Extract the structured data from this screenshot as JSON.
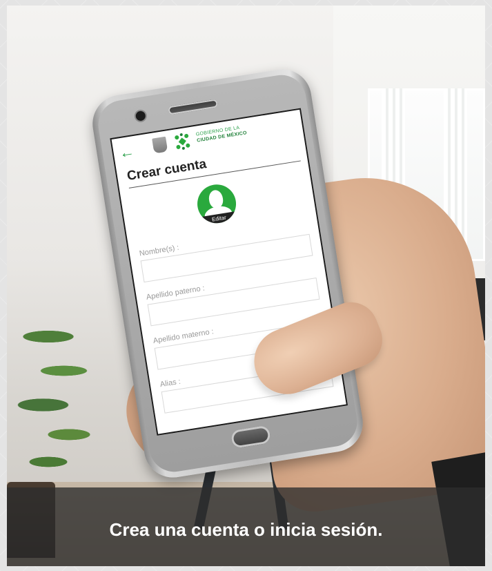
{
  "app": {
    "header": {
      "back_icon": "arrow-left-icon",
      "gov_line1": "GOBIERNO DE LA",
      "gov_line2": "CIUDAD DE MÉXICO",
      "logo_icon": "cdmx-logo-icon",
      "crest_icon": "coat-of-arms-icon"
    },
    "title": "Crear cuenta",
    "avatar": {
      "icon": "user-silhouette-icon",
      "edit_label": "Editar"
    },
    "fields": [
      {
        "label": "Nombre(s) :",
        "value": ""
      },
      {
        "label": "Apellido paterno :",
        "value": ""
      },
      {
        "label": "Apellido materno :",
        "value": ""
      },
      {
        "label": "Alias :",
        "value": ""
      }
    ]
  },
  "caption": "Crea una cuenta o inicia sesión.",
  "colors": {
    "accent_green": "#2aa93d",
    "caption_bg": "#2d2d2d",
    "text_dark": "#222222"
  }
}
